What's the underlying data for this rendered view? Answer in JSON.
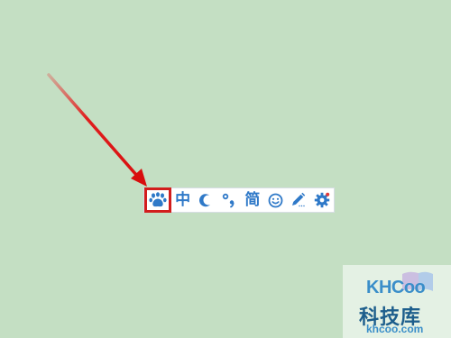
{
  "toolbar": {
    "items": [
      {
        "name": "baidu-paw-logo",
        "icon": "paw-icon",
        "highlighted": true
      },
      {
        "name": "chinese-mode",
        "label": "中",
        "icon": "text"
      },
      {
        "name": "half-full-width",
        "icon": "moon-icon"
      },
      {
        "name": "punctuation",
        "label": "°,",
        "icon": "punctuation-icon"
      },
      {
        "name": "simplified",
        "label": "简",
        "icon": "text"
      },
      {
        "name": "emoji",
        "icon": "smiley-icon"
      },
      {
        "name": "handwriting",
        "icon": "pen-icon"
      },
      {
        "name": "settings",
        "icon": "gear-icon"
      }
    ]
  },
  "watermark": {
    "logo_text": "KHCoo",
    "chinese_text": "科技库",
    "url": "khcoo.com"
  },
  "colors": {
    "background": "#c4dfc3",
    "highlight": "#d21d1d",
    "icon": "#2f79c8"
  }
}
